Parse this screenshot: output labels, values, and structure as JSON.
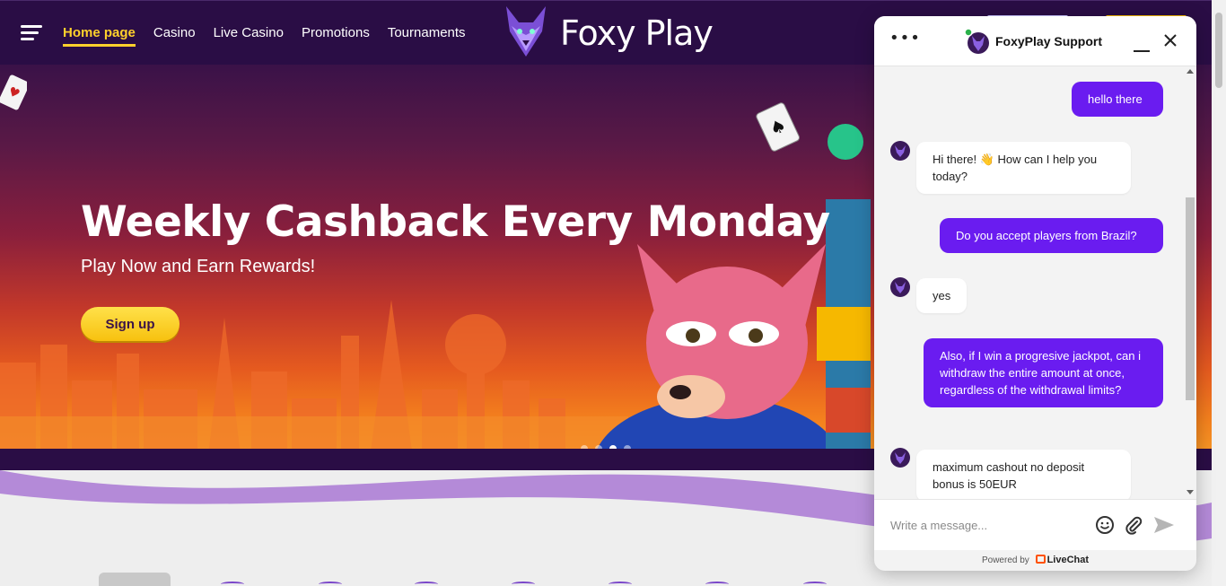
{
  "nav": {
    "items": [
      {
        "label": "Home page",
        "active": true
      },
      {
        "label": "Casino"
      },
      {
        "label": "Live Casino"
      },
      {
        "label": "Promotions"
      },
      {
        "label": "Tournaments"
      }
    ]
  },
  "brand": {
    "name": "Foxy Play",
    "accent": "#6a1cf0",
    "cta": "#ffd02c"
  },
  "hero": {
    "title": "Weekly Cashback Every Monday",
    "subtitle": "Play Now and Earn Rewards!",
    "cta_label": "Sign up",
    "slides": 4,
    "active_slide": 3
  },
  "chat": {
    "title": "FoxyPlay Support",
    "messages": [
      {
        "from": "user",
        "text": "hello there"
      },
      {
        "from": "agent",
        "text": "Hi there! 👋 How can I help you today?"
      },
      {
        "from": "user",
        "text": "Do you accept players from Brazil?"
      },
      {
        "from": "agent",
        "text": "yes"
      },
      {
        "from": "user",
        "text": "Also, if I win a progresive jackpot, can i withdraw the entire amount at once, regardless of the withdrawal limits?"
      },
      {
        "from": "agent",
        "text": "maximum cashout no deposit bonus is 50EUR"
      }
    ],
    "input_placeholder": "Write a message...",
    "powered_by": "Powered by",
    "provider": "LiveChat"
  }
}
